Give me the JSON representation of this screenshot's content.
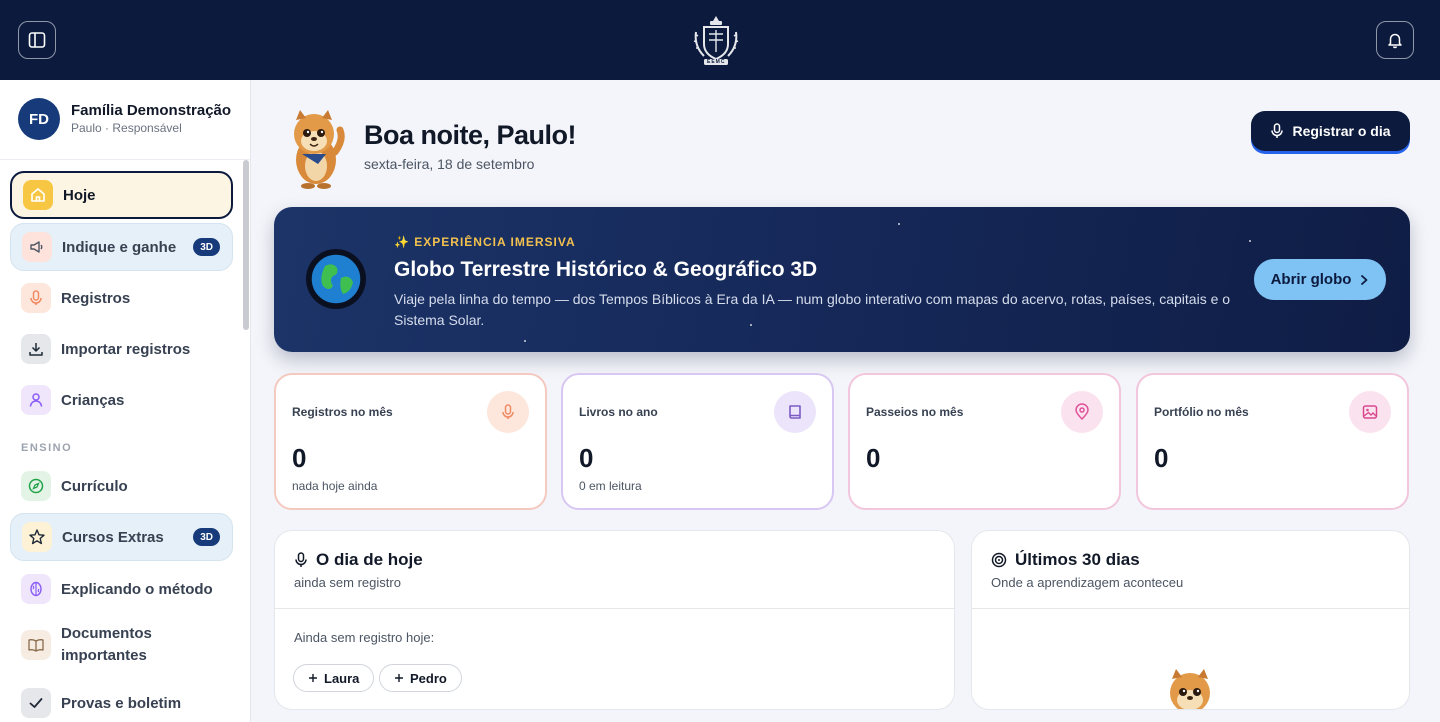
{
  "topbar": {
    "sidebar_toggle_icon": "sidebar-panel-icon",
    "logo_icon": "crest-logo",
    "logo_text": "EEMC",
    "notification_icon": "bell-icon"
  },
  "sidebar": {
    "family_initials": "FD",
    "family_name": "Família Demonstração",
    "family_role": "Paulo · Responsável",
    "section_ensino": "ENSINO",
    "items": [
      {
        "label": "Hoje",
        "icon": "home-icon",
        "badge": ""
      },
      {
        "label": "Indique e ganhe",
        "icon": "megaphone-icon",
        "badge": "3D"
      },
      {
        "label": "Registros",
        "icon": "microphone-icon",
        "badge": ""
      },
      {
        "label": "Importar registros",
        "icon": "download-icon",
        "badge": ""
      },
      {
        "label": "Crianças",
        "icon": "person-icon",
        "badge": ""
      },
      {
        "label": "Currículo",
        "icon": "compass-icon",
        "badge": ""
      },
      {
        "label": "Cursos Extras",
        "icon": "star-icon",
        "badge": "3D"
      },
      {
        "label": "Explicando o método",
        "icon": "brain-icon",
        "badge": ""
      },
      {
        "label": "Documentos importantes",
        "icon": "book-open-icon",
        "badge": ""
      },
      {
        "label": "Provas e boletim",
        "icon": "check-icon",
        "badge": ""
      }
    ]
  },
  "greeting": {
    "title": "Boa noite, Paulo!",
    "date": "sexta-feira, 18 de setembro",
    "register_button": "Registrar o dia"
  },
  "hero": {
    "kicker": "✨ EXPERIÊNCIA IMERSIVA",
    "title": "Globo Terrestre Histórico & Geográfico 3D",
    "description": "Viaje pela linha do tempo — dos Tempos Bíblicos à Era da IA — num globo interativo com mapas do acervo, rotas, países, capitais e o Sistema Solar.",
    "button": "Abrir globo"
  },
  "stats": [
    {
      "label": "Registros no mês",
      "value": "0",
      "sub": "nada hoje ainda",
      "icon": "microphone-icon",
      "color": "#f4a483",
      "bg": "#fde7dd"
    },
    {
      "label": "Livros no ano",
      "value": "0",
      "sub": "0 em leitura",
      "icon": "book-icon",
      "color": "#7c5cc4",
      "bg": "#ece4fa"
    },
    {
      "label": "Passeios no mês",
      "value": "0",
      "sub": "",
      "icon": "map-pin-icon",
      "color": "#e0529a",
      "bg": "#fbe2ef"
    },
    {
      "label": "Portfólio no mês",
      "value": "0",
      "sub": "",
      "icon": "image-icon",
      "color": "#d9488f",
      "bg": "#fbe2ef"
    }
  ],
  "today_panel": {
    "title": "O dia de hoje",
    "subtitle": "ainda sem registro",
    "body": "Ainda sem registro hoje:",
    "children": [
      "Laura",
      "Pedro"
    ]
  },
  "last30_panel": {
    "title": "Últimos 30 dias",
    "subtitle": "Onde a aprendizagem aconteceu"
  }
}
